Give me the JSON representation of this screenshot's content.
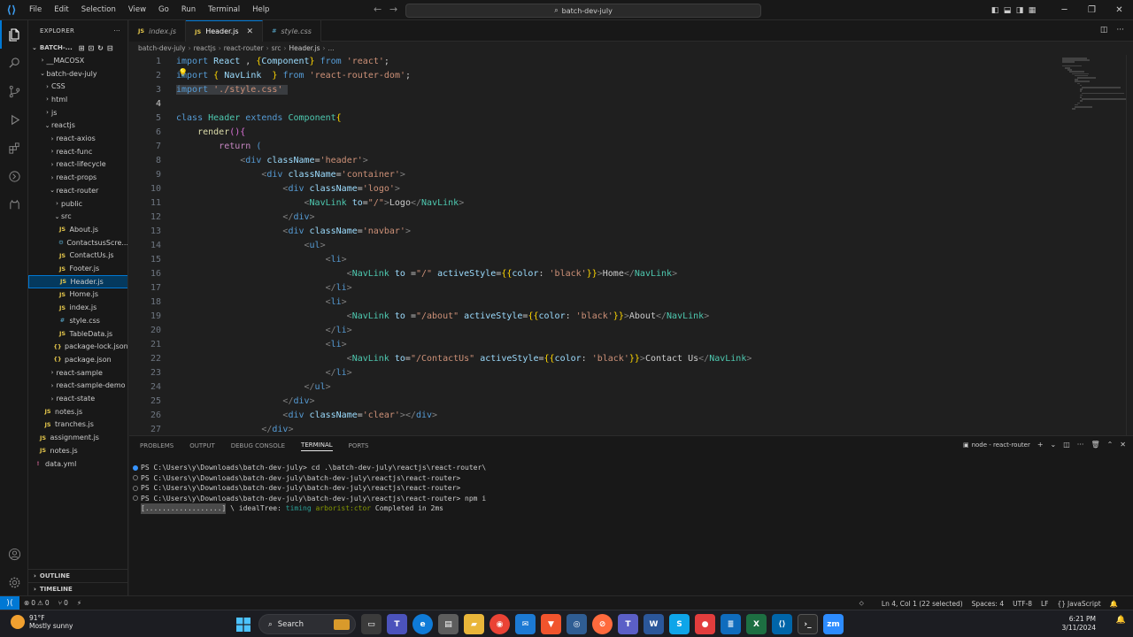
{
  "menu": [
    "File",
    "Edit",
    "Selection",
    "View",
    "Go",
    "Run",
    "Terminal",
    "Help"
  ],
  "command_center": "batch-dev-july",
  "sidebar": {
    "title": "EXPLORER",
    "section": "BATCH-...",
    "tree": [
      {
        "label": "__MACOSX",
        "type": "folder",
        "depth": 1,
        "open": false
      },
      {
        "label": "batch-dev-july",
        "type": "folder",
        "depth": 1,
        "open": true
      },
      {
        "label": "CSS",
        "type": "folder",
        "depth": 2,
        "open": false
      },
      {
        "label": "html",
        "type": "folder",
        "depth": 2,
        "open": false
      },
      {
        "label": "js",
        "type": "folder",
        "depth": 2,
        "open": false
      },
      {
        "label": "reactjs",
        "type": "folder",
        "depth": 2,
        "open": true
      },
      {
        "label": "react-axios",
        "type": "folder",
        "depth": 3,
        "open": false
      },
      {
        "label": "react-func",
        "type": "folder",
        "depth": 3,
        "open": false
      },
      {
        "label": "react-lifecycle",
        "type": "folder",
        "depth": 3,
        "open": false
      },
      {
        "label": "react-props",
        "type": "folder",
        "depth": 3,
        "open": false
      },
      {
        "label": "react-router",
        "type": "folder",
        "depth": 3,
        "open": true
      },
      {
        "label": "public",
        "type": "folder",
        "depth": 4,
        "open": false
      },
      {
        "label": "src",
        "type": "folder",
        "depth": 4,
        "open": true
      },
      {
        "label": "About.js",
        "type": "js",
        "depth": 5
      },
      {
        "label": "ContactsusScre...",
        "type": "tsx",
        "depth": 5
      },
      {
        "label": "ContactUs.js",
        "type": "js",
        "depth": 5
      },
      {
        "label": "Footer.js",
        "type": "js",
        "depth": 5
      },
      {
        "label": "Header.js",
        "type": "js",
        "depth": 5,
        "selected": true
      },
      {
        "label": "Home.js",
        "type": "js",
        "depth": 5
      },
      {
        "label": "index.js",
        "type": "js",
        "depth": 5
      },
      {
        "label": "style.css",
        "type": "css",
        "depth": 5
      },
      {
        "label": "TableData.js",
        "type": "js",
        "depth": 5
      },
      {
        "label": "package-lock.json",
        "type": "json",
        "depth": 4
      },
      {
        "label": "package.json",
        "type": "json",
        "depth": 4
      },
      {
        "label": "react-sample",
        "type": "folder",
        "depth": 3,
        "open": false
      },
      {
        "label": "react-sample-demo",
        "type": "folder",
        "depth": 3,
        "open": false
      },
      {
        "label": "react-state",
        "type": "folder",
        "depth": 3,
        "open": false
      },
      {
        "label": "notes.js",
        "type": "js",
        "depth": 2
      },
      {
        "label": "tranches.js",
        "type": "js",
        "depth": 2
      },
      {
        "label": "assignment.js",
        "type": "js",
        "depth": 1
      },
      {
        "label": "notes.js",
        "type": "js",
        "depth": 1
      },
      {
        "label": "data.yml",
        "type": "yml",
        "depth": 0
      }
    ],
    "outline": "OUTLINE",
    "timeline": "TIMELINE"
  },
  "tabs": [
    {
      "label": "index.js",
      "icon": "JS",
      "active": false
    },
    {
      "label": "Header.js",
      "icon": "JS",
      "active": true
    },
    {
      "label": "style.css",
      "icon": "#",
      "active": false
    }
  ],
  "breadcrumb": [
    "batch-dev-july",
    "reactjs",
    "react-router",
    "src",
    "Header.js",
    "..."
  ],
  "code": [
    {
      "n": 1,
      "html": "<span class='k'>import</span> <span class='a'>React</span> , <span class='b'>{</span><span class='a'>Component</span><span class='b'>}</span> <span class='k'>from</span> <span class='s'>'react'</span>;"
    },
    {
      "n": 2,
      "html": "<span class='k'>import</span> <span class='b'>{</span> <span class='a'>NavLink</span>  <span class='b'>}</span> <span class='k'>from</span> <span class='s'>'react-router-dom'</span>;"
    },
    {
      "n": 3,
      "html": "<span class='selbg'><span class='k'>import</span> <span class='s'>'./style.css'</span> </span>"
    },
    {
      "n": 4,
      "html": ""
    },
    {
      "n": 5,
      "html": "<span class='k'>class</span> <span class='c'>Header</span> <span class='k'>extends</span> <span class='c'>Component</span><span class='b'>{</span>"
    },
    {
      "n": 6,
      "html": "    <span class='f'>render</span><span class='p'>()</span><span class='p'>{</span>"
    },
    {
      "n": 7,
      "html": "        <span class='kc'>return</span> <span class='k'>(</span>"
    },
    {
      "n": 8,
      "html": "            <span class='br'>&lt;</span><span class='t'>div</span> <span class='a'>className</span>=<span class='s'>'header'</span><span class='br'>&gt;</span>"
    },
    {
      "n": 9,
      "html": "                <span class='br'>&lt;</span><span class='t'>div</span> <span class='a'>className</span>=<span class='s'>'container'</span><span class='br'>&gt;</span>"
    },
    {
      "n": 10,
      "html": "                    <span class='br'>&lt;</span><span class='t'>div</span> <span class='a'>className</span>=<span class='s'>'logo'</span><span class='br'>&gt;</span>"
    },
    {
      "n": 11,
      "html": "                        <span class='br'>&lt;</span><span class='tg'>NavLink</span> <span class='a'>to</span>=<span class='s'>\"/\"</span><span class='br'>&gt;</span>Logo<span class='br'>&lt;/</span><span class='tg'>NavLink</span><span class='br'>&gt;</span>"
    },
    {
      "n": 12,
      "html": "                    <span class='br'>&lt;/</span><span class='t'>div</span><span class='br'>&gt;</span>"
    },
    {
      "n": 13,
      "html": "                    <span class='br'>&lt;</span><span class='t'>div</span> <span class='a'>className</span>=<span class='s'>'navbar'</span><span class='br'>&gt;</span>"
    },
    {
      "n": 14,
      "html": "                        <span class='br'>&lt;</span><span class='t'>ul</span><span class='br'>&gt;</span>"
    },
    {
      "n": 15,
      "html": "                            <span class='br'>&lt;</span><span class='t'>li</span><span class='br'>&gt;</span>"
    },
    {
      "n": 16,
      "html": "                                <span class='br'>&lt;</span><span class='tg'>NavLink</span> <span class='a'>to</span> =<span class='s'>\"/\"</span> <span class='a'>activeStyle</span>=<span class='b'>{{</span><span class='a'>color</span>: <span class='s'>'black'</span><span class='b'>}}</span><span class='br'>&gt;</span>Home<span class='br'>&lt;/</span><span class='tg'>NavLink</span><span class='br'>&gt;</span>"
    },
    {
      "n": 17,
      "html": "                            <span class='br'>&lt;/</span><span class='t'>li</span><span class='br'>&gt;</span>"
    },
    {
      "n": 18,
      "html": "                            <span class='br'>&lt;</span><span class='t'>li</span><span class='br'>&gt;</span>"
    },
    {
      "n": 19,
      "html": "                                <span class='br'>&lt;</span><span class='tg'>NavLink</span> <span class='a'>to</span> =<span class='s'>\"/about\"</span> <span class='a'>activeStyle</span>=<span class='b'>{{</span><span class='a'>color</span>: <span class='s'>'black'</span><span class='b'>}}</span><span class='br'>&gt;</span>About<span class='br'>&lt;/</span><span class='tg'>NavLink</span><span class='br'>&gt;</span>"
    },
    {
      "n": 20,
      "html": "                            <span class='br'>&lt;/</span><span class='t'>li</span><span class='br'>&gt;</span>"
    },
    {
      "n": 21,
      "html": "                            <span class='br'>&lt;</span><span class='t'>li</span><span class='br'>&gt;</span>"
    },
    {
      "n": 22,
      "html": "                                <span class='br'>&lt;</span><span class='tg'>NavLink</span> <span class='a'>to</span>=<span class='s'>\"/ContactUs\"</span> <span class='a'>activeStyle</span>=<span class='b'>{{</span><span class='a'>color</span>: <span class='s'>'black'</span><span class='b'>}}</span><span class='br'>&gt;</span>Contact Us<span class='br'>&lt;/</span><span class='tg'>NavLink</span><span class='br'>&gt;</span>"
    },
    {
      "n": 23,
      "html": "                            <span class='br'>&lt;/</span><span class='t'>li</span><span class='br'>&gt;</span>"
    },
    {
      "n": 24,
      "html": "                        <span class='br'>&lt;/</span><span class='t'>ul</span><span class='br'>&gt;</span>"
    },
    {
      "n": 25,
      "html": "                    <span class='br'>&lt;/</span><span class='t'>div</span><span class='br'>&gt;</span>"
    },
    {
      "n": 26,
      "html": "                    <span class='br'>&lt;</span><span class='t'>div</span> <span class='a'>className</span>=<span class='s'>'clear'</span><span class='br'>&gt;&lt;/</span><span class='t'>div</span><span class='br'>&gt;</span>"
    },
    {
      "n": 27,
      "html": "                <span class='br'>&lt;/</span><span class='t'>div</span><span class='br'>&gt;</span>"
    }
  ],
  "panel": {
    "tabs": [
      "PROBLEMS",
      "OUTPUT",
      "DEBUG CONSOLE",
      "TERMINAL",
      "PORTS"
    ],
    "active_tab": "TERMINAL",
    "terminal_name": "node - react-router",
    "lines": [
      "PS C:\\Users\\y\\Downloads\\batch-dev-july> cd .\\batch-dev-july\\reactjs\\react-router\\",
      "PS C:\\Users\\y\\Downloads\\batch-dev-july\\batch-dev-july\\reactjs\\react-router>",
      "PS C:\\Users\\y\\Downloads\\batch-dev-july\\batch-dev-july\\reactjs\\react-router>",
      "PS C:\\Users\\y\\Downloads\\batch-dev-july\\batch-dev-july\\reactjs\\react-router> npm i"
    ],
    "progress_line": {
      "bar": "[..................]",
      "rest": " \\ idealTree: ",
      "timing": "timing",
      "pkg": " arborist:ctor",
      "done": " Completed in 2ms"
    }
  },
  "status": {
    "errors": "0",
    "warnings": "0",
    "ports": "0",
    "cursor": "Ln 4, Col 1 (22 selected)",
    "spaces": "Spaces: 4",
    "encoding": "UTF-8",
    "eol": "LF",
    "language": "JavaScript"
  },
  "taskbar": {
    "temp": "91°F",
    "weather": "Mostly sunny",
    "search": "Search",
    "time": "6:21 PM",
    "date": "3/11/2024"
  },
  "colors": {
    "accent": "#0078d4",
    "selection": "#04395e"
  }
}
